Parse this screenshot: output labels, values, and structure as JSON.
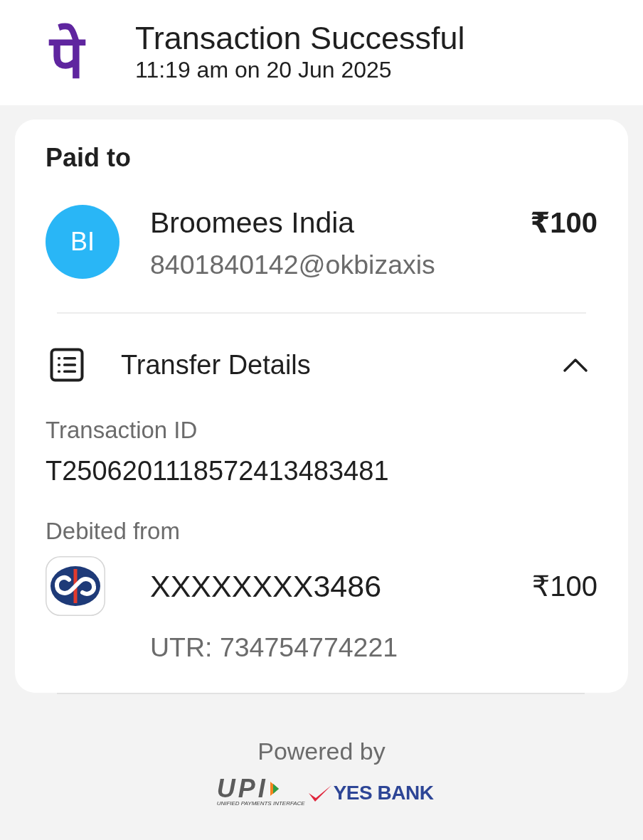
{
  "header": {
    "logo": "पे",
    "title": "Transaction Successful",
    "timestamp": "11:19 am on 20 Jun 2025"
  },
  "payment": {
    "heading": "Paid to",
    "payee": {
      "initials": "BI",
      "name": "Broomees India",
      "upi_id": "8401840142@okbizaxis",
      "amount": "₹100"
    }
  },
  "transfer_details": {
    "title": "Transfer Details",
    "expanded": true,
    "transaction_id": {
      "label": "Transaction ID",
      "value": "T2506201118572413483481"
    },
    "debited_from": {
      "label": "Debited from",
      "account": "XXXXXXXX3486",
      "amount": "₹100",
      "utr": "UTR: 734754774221"
    }
  },
  "footer": {
    "caption": "Powered by",
    "upi_logo": {
      "text": "UPI",
      "subtitle": "UNIFIED PAYMENTS INTERFACE"
    },
    "bank": "YES BANK"
  }
}
